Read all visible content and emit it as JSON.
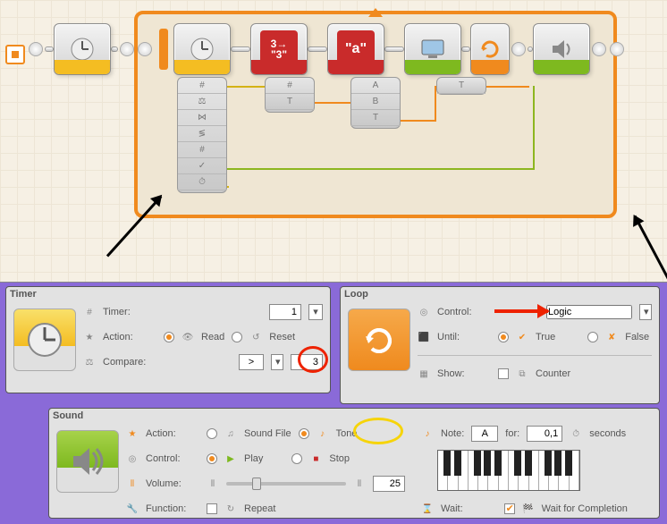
{
  "canvas": {
    "blocks": [
      {
        "type": "timer",
        "color": "yellow"
      },
      {
        "type": "timer",
        "color": "yellow"
      },
      {
        "type": "num2text",
        "color": "red",
        "glyph": "3\n\"3\""
      },
      {
        "type": "text",
        "color": "red",
        "glyph": "\"a\""
      },
      {
        "type": "display",
        "color": "green"
      },
      {
        "type": "loopend",
        "color": "orange"
      },
      {
        "type": "sound",
        "color": "green"
      }
    ]
  },
  "timer_panel": {
    "title": "Timer",
    "timer_label": "Timer:",
    "timer_value": "1",
    "action_label": "Action:",
    "action_read": "Read",
    "action_reset": "Reset",
    "action_selected": "read",
    "compare_label": "Compare:",
    "compare_op": ">",
    "compare_value": "3"
  },
  "loop_panel": {
    "title": "Loop",
    "control_label": "Control:",
    "control_value": "Logic",
    "until_label": "Until:",
    "until_true": "True",
    "until_false": "False",
    "until_selected": "true",
    "show_label": "Show:",
    "counter_label": "Counter"
  },
  "sound_panel": {
    "title": "Sound",
    "action_label": "Action:",
    "action_file": "Sound File",
    "action_tone": "Tone",
    "action_selected": "tone",
    "control_label": "Control:",
    "control_play": "Play",
    "control_stop": "Stop",
    "control_selected": "play",
    "volume_label": "Volume:",
    "volume_value": "25",
    "function_label": "Function:",
    "repeat_label": "Repeat",
    "note_label": "Note:",
    "note_value": "A",
    "for_label": "for:",
    "for_value": "0,1",
    "seconds_label": "seconds",
    "wait_label": "Wait:",
    "wait_completion": "Wait for Completion"
  }
}
